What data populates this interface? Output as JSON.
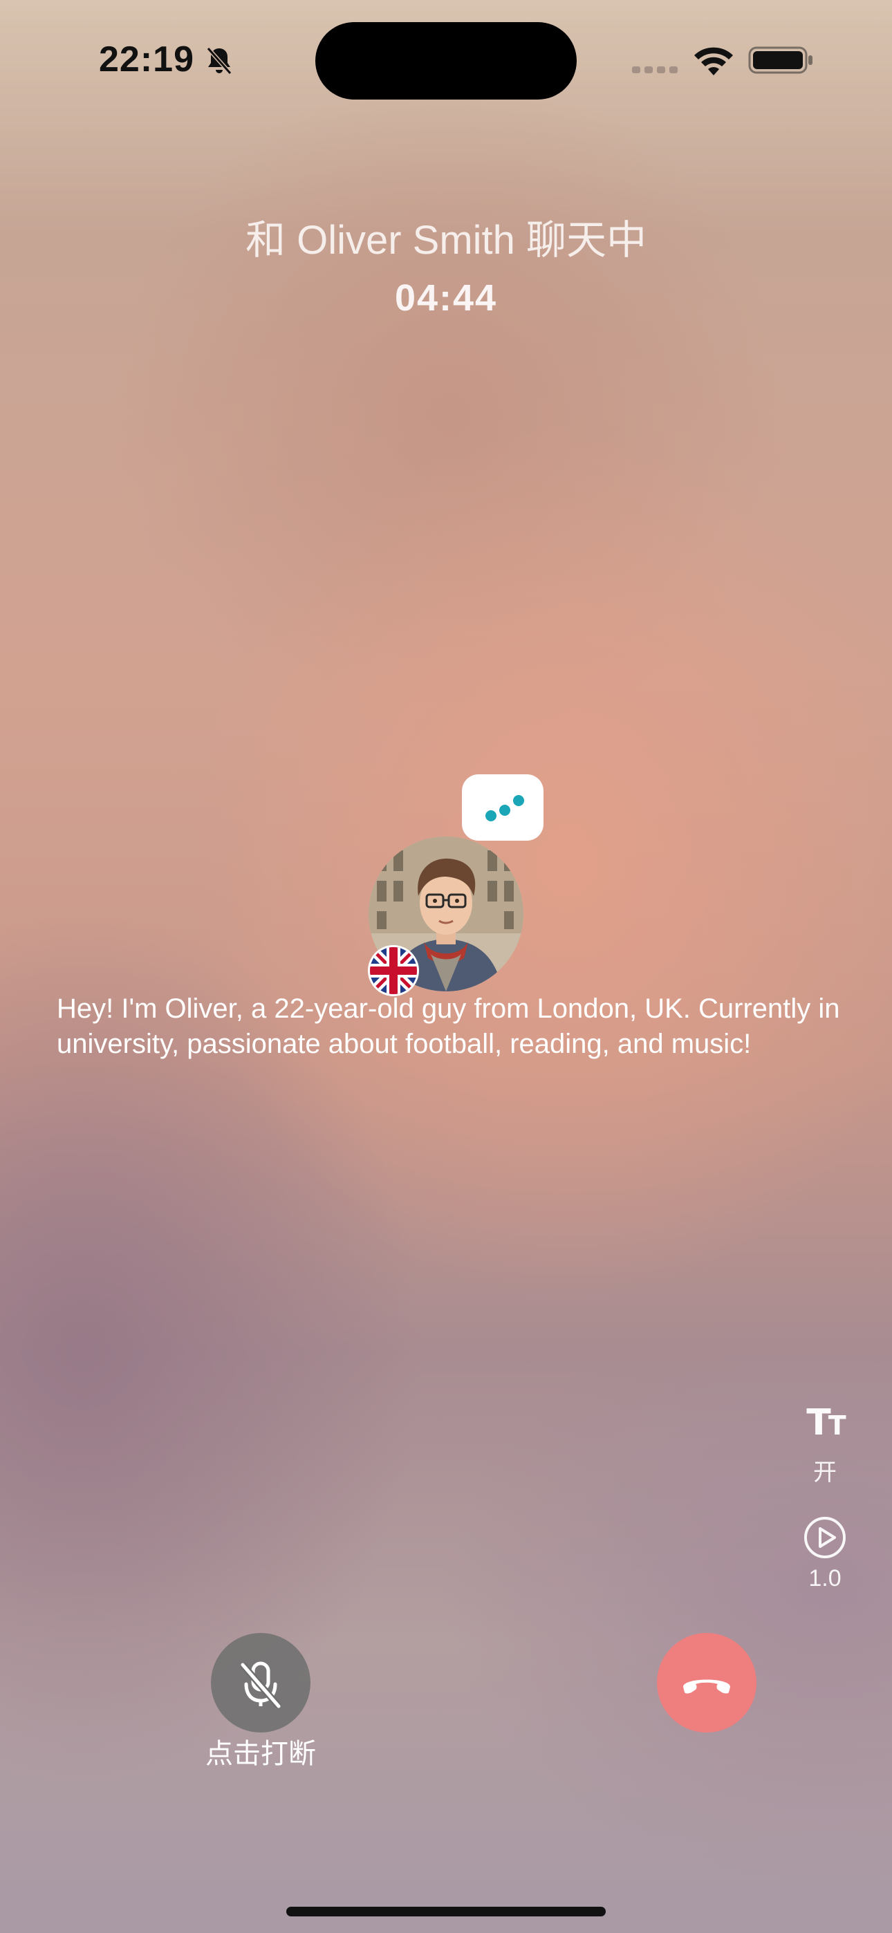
{
  "status_bar": {
    "time": "22:19",
    "icons": [
      "bell-slash-icon",
      "cellular-signal-icon",
      "wifi-icon",
      "battery-icon"
    ]
  },
  "call": {
    "title": "和 Oliver Smith 聊天中",
    "timer": "04:44"
  },
  "partner": {
    "avatar": "avatar-photo",
    "flag": "uk-flag-icon",
    "typing_indicator": "typing-dots-icon",
    "bio": "Hey! I'm Oliver, a 22-year-old guy from London, UK. Currently in university, passionate about football, reading, and music!"
  },
  "side_controls": {
    "captions_label": "开",
    "speed_label": "1.0"
  },
  "bottom_controls": {
    "mic_label": "点击打断",
    "mic_icon": "mic-off-icon",
    "hangup_icon": "phone-hangup-icon"
  },
  "colors": {
    "hangup": "#ef7e7e",
    "typing_dots": "#1aa6b7",
    "mic_button": "#6e6e6e"
  }
}
